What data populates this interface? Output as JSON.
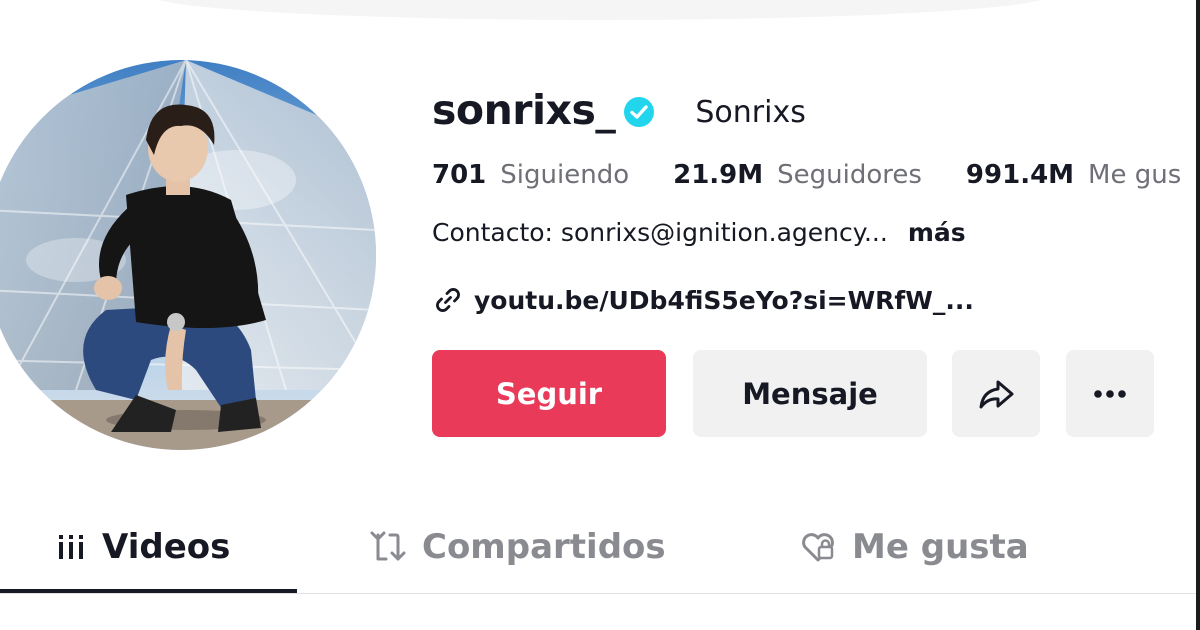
{
  "profile": {
    "username": "sonrixs_",
    "nickname": "Sonrixs",
    "verified": true,
    "stats": [
      {
        "value": "701",
        "label": "Siguiendo"
      },
      {
        "value": "21.9M",
        "label": "Seguidores"
      },
      {
        "value": "991.4M",
        "label": "Me gus"
      }
    ],
    "bio": "Contacto: sonrixs@ignition.agency...",
    "bio_more": "más",
    "link": "youtu.be/UDb4fiS5eYo?si=WRfW_..."
  },
  "actions": {
    "follow_label": "Seguir",
    "message_label": "Mensaje",
    "share_icon": "share-arrow-icon",
    "more_icon": "more-dots-icon"
  },
  "tabs": [
    {
      "label": "Videos",
      "icon": "grid-bars-icon",
      "active": true
    },
    {
      "label": "Compartidos",
      "icon": "repost-icon",
      "active": false
    },
    {
      "label": "Me gusta",
      "icon": "heart-lock-icon",
      "active": false
    }
  ],
  "colors": {
    "follow": "#ea3a59",
    "verified": "#20d5ec",
    "secondary_text": "#6f7077",
    "button_bg": "#f1f1f2"
  }
}
